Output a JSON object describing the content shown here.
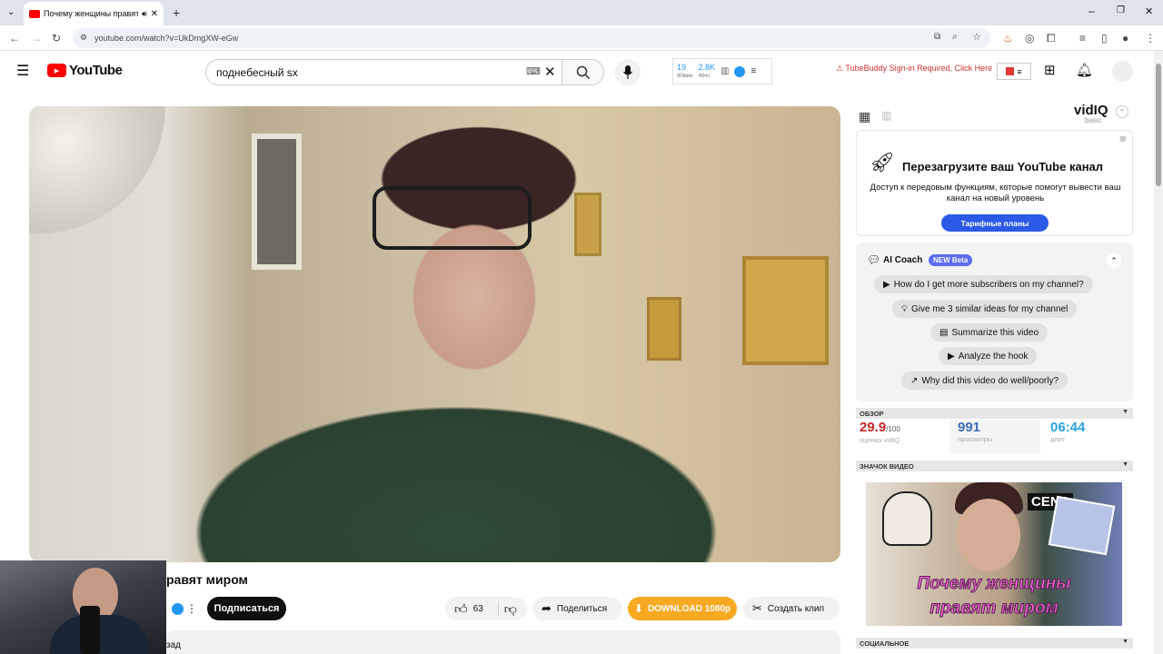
{
  "browser": {
    "tab_title": "Почему женщины правят",
    "url": "youtube.com/watch?v=UkDmgXW-eGw"
  },
  "masthead": {
    "logo_text": "YouTube",
    "search_value": "поднебесный sx",
    "stats": {
      "v1": "19",
      "v1_label": "60мин",
      "v2": "2.8K",
      "v2_label": "48чс"
    },
    "tubebuddy_notice": "TubeBuddy Sign-in Required, Click Here"
  },
  "video": {
    "title_visible": "равят миром",
    "subscribe_label": "Подписаться",
    "likes": "63",
    "share_label": "Поделиться",
    "download_label": "DOWNLOAD 1080p",
    "clip_label": "Создать клип",
    "description_peek": "зад"
  },
  "vidiq": {
    "logo": "vidIQ",
    "plan": "basic",
    "promo": {
      "title": "Перезагрузите ваш YouTube канал",
      "text": "Доступ к передовым функциям, которые помогут вывести ваш канал на новый уровень",
      "button": "Тарифные планы"
    },
    "coach": {
      "title": "AI Coach",
      "badge": "NEW Beta",
      "questions": [
        "How do I get more subscribers on my channel?",
        "Give me 3 similar ideas for my channel",
        "Summarize this video",
        "Analyze the hook",
        "Why did this video do well/poorly?"
      ]
    },
    "overview": {
      "header": "ОБЗОР",
      "score": "29.9",
      "score_max": "/100",
      "score_label": "оценка vidIQ",
      "views": "991",
      "views_label": "просмотры",
      "duration": "06:44",
      "duration_label": "длит"
    },
    "thumbnail": {
      "header": "ЗНАЧОК ВИДЕО",
      "text_line1": "Почему женщины",
      "text_line2": "правят миром",
      "cens_text": "CENS"
    },
    "social_header": "СОЦИАЛЬНОЕ"
  },
  "colors": {
    "youtube_red": "#ff0000",
    "vidiq_blue": "#2b59e8",
    "download_orange": "#f7a922",
    "score_red": "#c62828"
  }
}
